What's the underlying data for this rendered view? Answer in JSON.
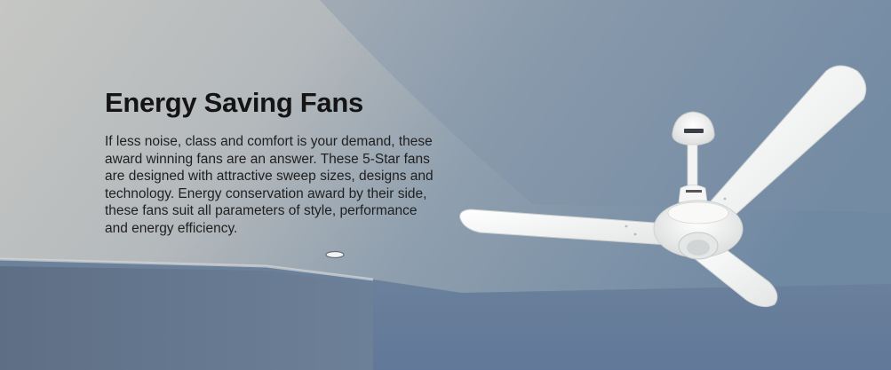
{
  "banner": {
    "title": "Energy Saving Fans",
    "description": "If less noise, class and comfort is your demand, these award winning fans are an answer. These 5-Star fans are designed with attractive sweep sizes, designs and technology. Energy conservation award by their side, these fans suit all parameters of style, performance and energy efficiency."
  },
  "product_image": {
    "icon": "ceiling-fan-image",
    "canopy_logo": "USHA",
    "motor_logo": "USHA"
  },
  "colors": {
    "title": "#141414",
    "text": "#1f1f1f",
    "wall": "#6e86a0",
    "ceiling": "#c9cac8",
    "fan_body": "#f7f7f5"
  }
}
